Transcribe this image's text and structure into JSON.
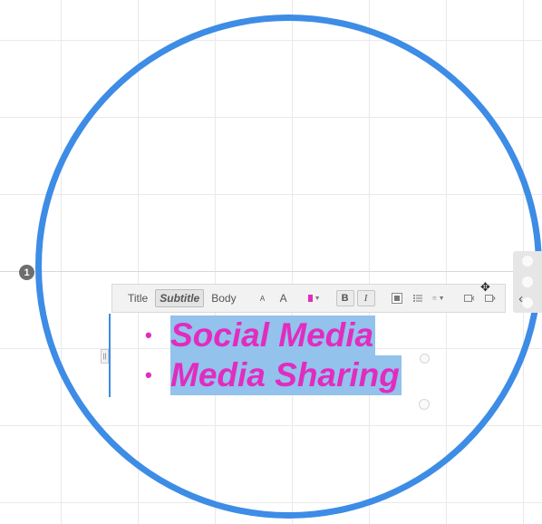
{
  "slide": {
    "number_badge": "1"
  },
  "toolbar": {
    "styles": {
      "title": "Title",
      "subtitle": "Subtitle",
      "body": "Body"
    },
    "font_size_down": "A",
    "font_size_up": "A",
    "bold": "B",
    "italic": "I",
    "text_color": "#e12cc0",
    "collapse": "‹"
  },
  "textbox": {
    "bullets": [
      "Social Media",
      "Media Sharing"
    ],
    "bullet_glyph": "•"
  },
  "colors": {
    "accent": "#3d8ce6",
    "text": "#e12cc0",
    "selection": "#93c2ec"
  }
}
